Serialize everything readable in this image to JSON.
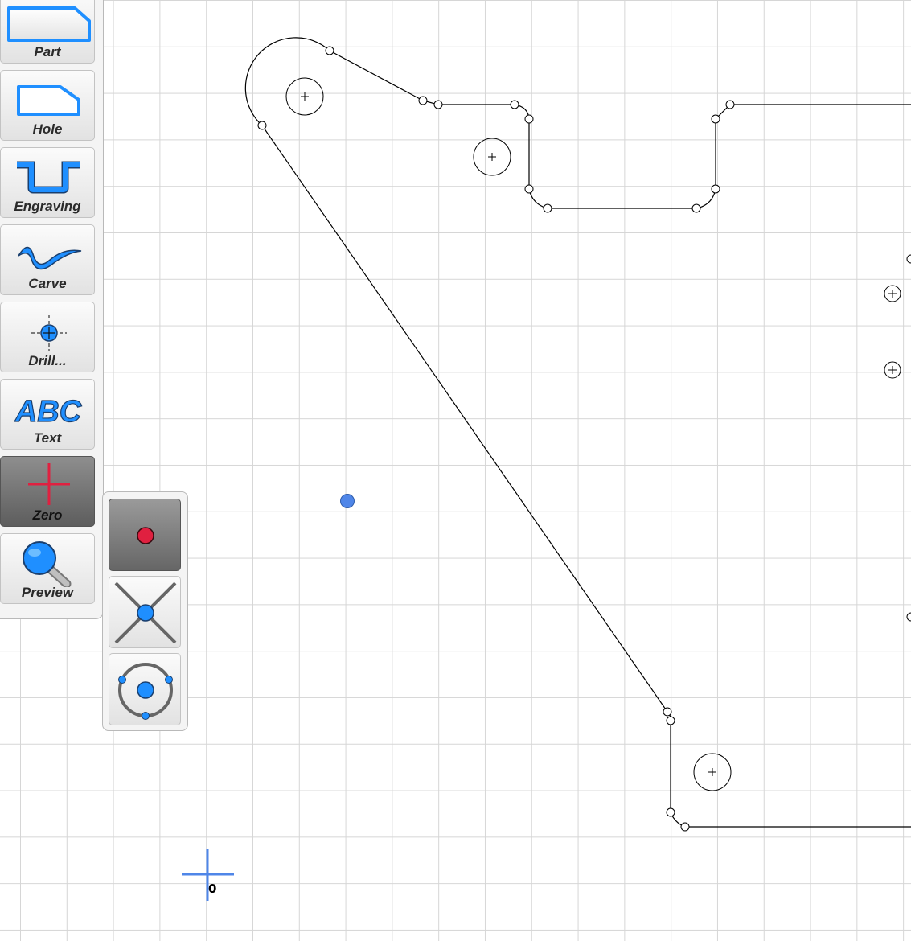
{
  "toolbar": {
    "tools": [
      {
        "label": "Part",
        "icon": "part-shape-icon"
      },
      {
        "label": "Hole",
        "icon": "hole-shape-icon"
      },
      {
        "label": "Engraving",
        "icon": "engraving-icon"
      },
      {
        "label": "Carve",
        "icon": "carve-icon"
      },
      {
        "label": "Drill...",
        "icon": "drill-crosshair-icon"
      },
      {
        "label": "Text",
        "icon": "text-abc-icon"
      },
      {
        "label": "Zero",
        "icon": "zero-cross-icon",
        "active": true
      },
      {
        "label": "Preview",
        "icon": "magnifier-icon"
      }
    ],
    "icon_text_abc": "ABC"
  },
  "zero_submenu": {
    "options": [
      {
        "name": "zero-at-point",
        "icon": "red-dot-icon",
        "active": true
      },
      {
        "name": "zero-at-intersection",
        "icon": "intersection-icon"
      },
      {
        "name": "zero-at-circle-center",
        "icon": "circle-center-icon"
      }
    ]
  },
  "canvas": {
    "origin_label": "0",
    "colors": {
      "grid": "#d6d6d6",
      "outline": "#000000",
      "origin_marker": "#4f86e8",
      "selected_point": "#4a7fe0",
      "accent_blue": "#1f8fff",
      "zero_red": "#e02040"
    }
  }
}
